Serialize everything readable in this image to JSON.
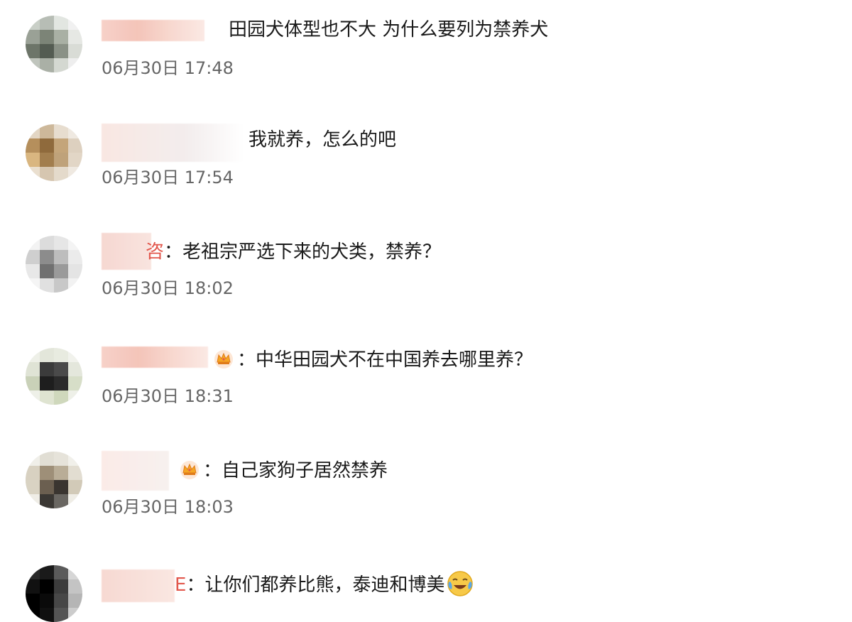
{
  "comments": [
    {
      "name_tail": "",
      "text": "田园犬体型也不大 为什么要列为禁养犬",
      "time": "06月30日 17:48",
      "badge": ""
    },
    {
      "name_tail": "",
      "text": "我就养，怎么的吧",
      "time": "06月30日 17:54",
      "badge": ""
    },
    {
      "name_tail": "咨",
      "text": "：老祖宗严选下来的犬类，禁养？",
      "time": "06月30日 18:02",
      "badge": ""
    },
    {
      "name_tail": "",
      "text": "：中华田园犬不在中国养去哪里养？",
      "time": "06月30日 18:31",
      "badge": "crown-icon"
    },
    {
      "name_tail": "",
      "text": "：自己家狗子居然禁养",
      "time": "06月30日 18:03",
      "badge": "crown-icon"
    },
    {
      "name_tail": "E",
      "text": "：让你们都养比熊，泰迪和博美",
      "time": "",
      "badge": "",
      "emoji": "laughing-crying-emoji-icon"
    }
  ],
  "colors": {
    "timestamp": "#666666",
    "name_blur": "#f4c2b6",
    "name_tail": "#e2574c",
    "crown": "#f5a623"
  }
}
